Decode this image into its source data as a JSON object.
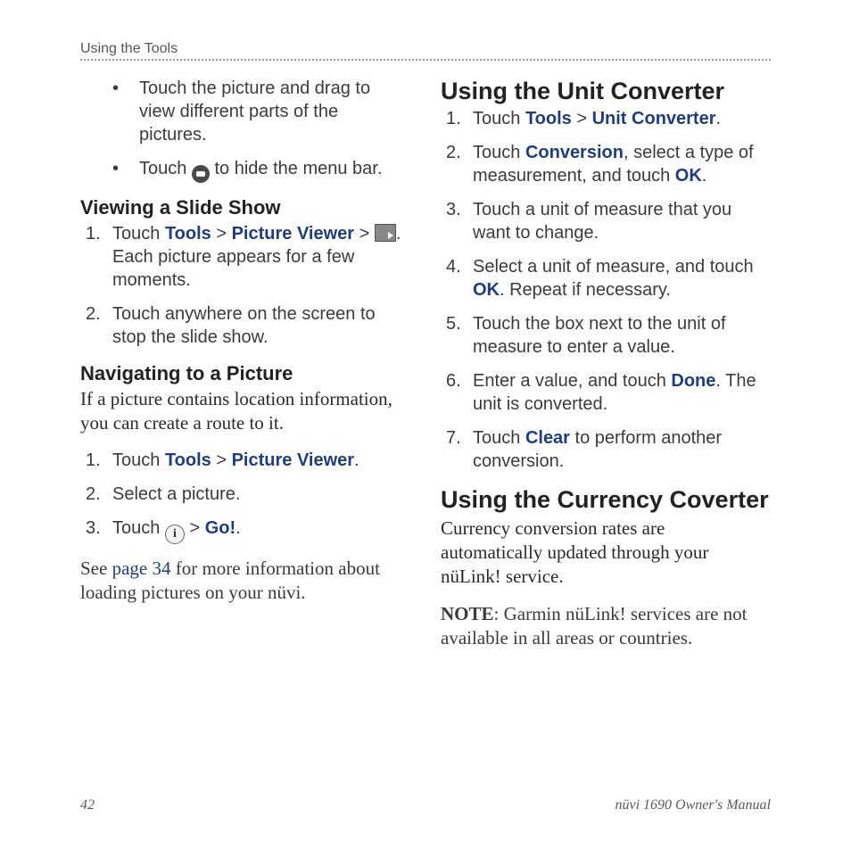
{
  "running_head": "Using the Tools",
  "page_number": "42",
  "footer_title": "nüvi 1690 Owner's Manual",
  "left": {
    "bullets": {
      "b1": "Touch the picture and drag to view different parts of the pictures.",
      "b2a": "Touch ",
      "b2b": " to hide the menu bar."
    },
    "h_slide": "Viewing a Slide Show",
    "slide": {
      "s1a": "Touch ",
      "s1_tools": "Tools",
      "s1_sep1": " > ",
      "s1_pv": "Picture Viewer",
      "s1_sep2": " > ",
      "s1b": ". Each picture appears for a few moments.",
      "s2": "Touch anywhere on the screen to stop the slide show."
    },
    "h_nav": "Navigating to a Picture",
    "nav_intro": "If a picture contains location information, you can create a route to it.",
    "nav": {
      "n1a": "Touch ",
      "n1_tools": "Tools",
      "n1_sep": " > ",
      "n1_pv": "Picture Viewer",
      "n1_end": ".",
      "n2": "Select a picture.",
      "n3a": "Touch ",
      "n3_sep": " > ",
      "n3_go": "Go!",
      "n3_end": "."
    },
    "after_a": "See ",
    "after_link": "page 34",
    "after_b": " for more information about loading pictures on your nüvi."
  },
  "right": {
    "h_unit": "Using the Unit Converter",
    "unit": {
      "u1a": "Touch ",
      "u1_tools": "Tools",
      "u1_sep": " > ",
      "u1_uc": "Unit Converter",
      "u1_end": ".",
      "u2a": "Touch ",
      "u2_conv": "Conversion",
      "u2b": ", select a type of measurement, and touch ",
      "u2_ok": "OK",
      "u2_end": ".",
      "u3": "Touch a unit of measure that you want to change.",
      "u4a": "Select a unit of measure, and touch ",
      "u4_ok": "OK",
      "u4b": ". Repeat if necessary.",
      "u5": "Touch the box next to the unit of measure to enter a value.",
      "u6a": "Enter a value, and touch ",
      "u6_done": "Done",
      "u6b": ". The unit is converted.",
      "u7a": "Touch ",
      "u7_clear": "Clear",
      "u7b": " to perform another conversion."
    },
    "h_curr": "Using the Currency Coverter",
    "curr_intro": "Currency conversion rates are automatically updated through your nüLink! service.",
    "note_label": "NOTE",
    "note_body": ": Garmin nüLink! services are not available in all areas or countries."
  }
}
